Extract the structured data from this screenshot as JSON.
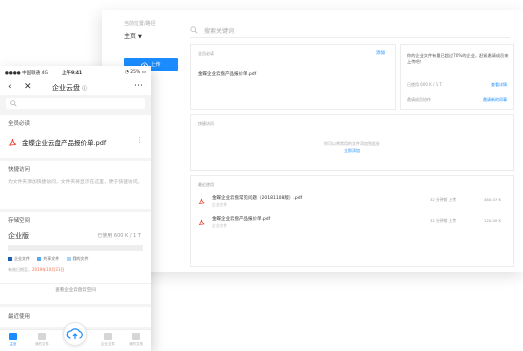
{
  "desktop": {
    "location_label": "当前位置/路径",
    "location_value": "主页",
    "upload_label": "上传",
    "search_placeholder": "搜索关键词",
    "must_read": {
      "title": "全员必读",
      "more": "添加",
      "file": "金蝶企业云盘产品报价单.pdf"
    },
    "notice": {
      "text": "你的企业文件有量已超过70%的企业，赶紧邀请成员来上传吧！",
      "rows": [
        {
          "label": "已使用 600 K / 1 T",
          "action": "查看详情"
        },
        {
          "label": "邀请成员协作",
          "action": "邀请新的同事"
        }
      ]
    },
    "quick_access": {
      "title": "快捷访问",
      "empty": "你可以将常用的文件添加到此处",
      "action": "立即添加"
    },
    "recent": {
      "title": "最近使用",
      "items": [
        {
          "name": "金蝶企业云盘常见问题（20181108版）.pdf",
          "sub": "企业文件",
          "time": "32 分钟前 上传",
          "size": "480.07 K"
        },
        {
          "name": "金蝶企业云盘产品报价单.pdf",
          "sub": "企业文件",
          "time": "32 分钟前 上传",
          "size": "120.00 K"
        }
      ]
    }
  },
  "phone": {
    "status": {
      "carrier": "中国联通",
      "network": "4G",
      "time": "上午9:41",
      "battery": "25%"
    },
    "title": "企业云盘",
    "must_read": {
      "title": "全员必读",
      "file": "金蝶企业云盘产品报价单.pdf",
      "more": "⋮"
    },
    "quick_access": {
      "title": "快捷访问",
      "desc": "为文件夹添加快捷访问，文件夹将显示在这里，便于快速访问。"
    },
    "storage": {
      "title": "存储空间",
      "plan": "企业版",
      "used": "已使用 600 K / 1 T",
      "legend": [
        "企业文件",
        "共享文件",
        "我的文件"
      ],
      "expire_prefix": "有效日期至，",
      "expire_date": "2019年10月31日",
      "link": "查看企业云盘云空间"
    },
    "recent": {
      "title": "最近使用"
    },
    "tabs": [
      "主页",
      "我的文件",
      "",
      "企业文件",
      "我的文档"
    ]
  },
  "colors": {
    "accent": "#1a8cff",
    "pdf": "#e8463b",
    "legend": [
      "#1a5fb4",
      "#5aa9f0",
      "#a8d4f8"
    ]
  }
}
